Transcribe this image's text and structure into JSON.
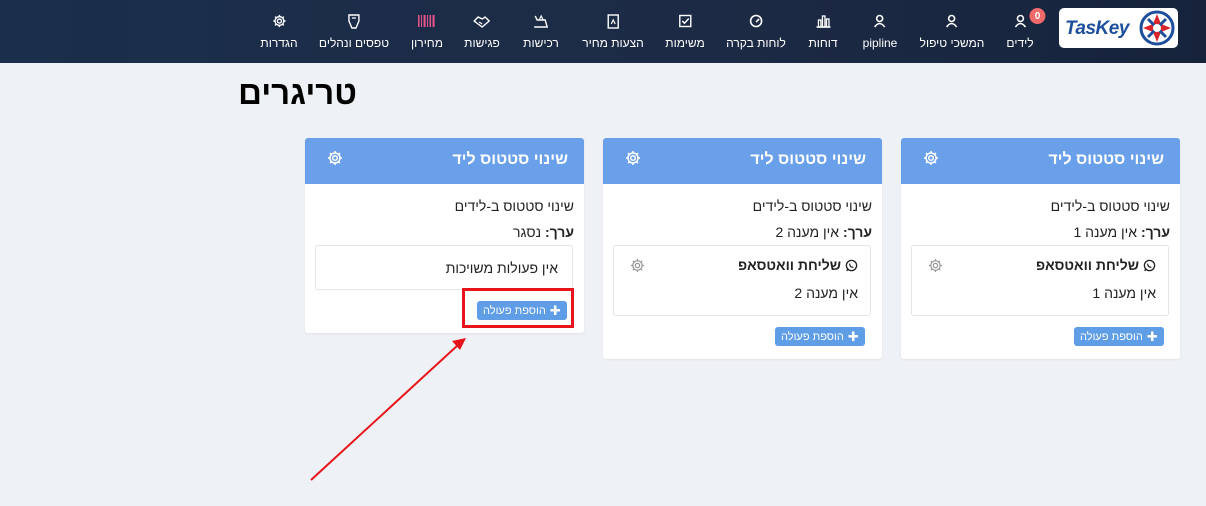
{
  "app": {
    "logo_text": "TasKey",
    "badge_count": "0"
  },
  "nav": [
    {
      "key": "leads",
      "label": "לידים",
      "icon": "person-icon"
    },
    {
      "key": "followup",
      "label": "המשכי טיפול",
      "icon": "person-icon"
    },
    {
      "key": "pipeline",
      "label": "pipline",
      "icon": "person-icon"
    },
    {
      "key": "reports",
      "label": "דוחות",
      "icon": "bar-chart-icon"
    },
    {
      "key": "dashboards",
      "label": "לוחות בקרה",
      "icon": "gauge-icon"
    },
    {
      "key": "tasks",
      "label": "משימות",
      "icon": "checkbox-icon"
    },
    {
      "key": "quotes",
      "label": "הצעות מחיר",
      "icon": "document-icon"
    },
    {
      "key": "purchases",
      "label": "רכישות",
      "icon": "cart-icon"
    },
    {
      "key": "meetings",
      "label": "פגישות",
      "icon": "handshake-icon"
    },
    {
      "key": "pricelist",
      "label": "מחירון",
      "icon": "barcode-icon"
    },
    {
      "key": "forms",
      "label": "טפסים ונהלים",
      "icon": "form-icon"
    },
    {
      "key": "settings",
      "label": "הגדרות",
      "icon": "gear-icon"
    }
  ],
  "page": {
    "title": "טריגרים"
  },
  "value_label": "ערך:",
  "add_action_label": "הוספת פעולה",
  "colors": {
    "header_bg": "#1a2f4b",
    "card_header": "#6aa0e9",
    "button": "#5f9ee6",
    "highlight": "#e8141b",
    "badge": "#f16a6a"
  },
  "triggers": [
    {
      "title": "שינוי סטטוס ליד",
      "description": "שינוי סטטוס ב-לידים",
      "value": "אין מענה 1",
      "actions": [
        {
          "title": "שליחת וואטסאפ",
          "subtitle": "אין מענה 1",
          "icon": "whatsapp-icon"
        }
      ]
    },
    {
      "title": "שינוי סטטוס ליד",
      "description": "שינוי סטטוס ב-לידים",
      "value": "אין מענה 2",
      "actions": [
        {
          "title": "שליחת וואטסאפ",
          "subtitle": "אין מענה 2",
          "icon": "whatsapp-icon"
        }
      ]
    },
    {
      "title": "שינוי סטטוס ליד",
      "description": "שינוי סטטוס ב-לידים",
      "value": "נסגר",
      "no_actions_text": "אין פעולות משויכות",
      "actions": []
    }
  ]
}
